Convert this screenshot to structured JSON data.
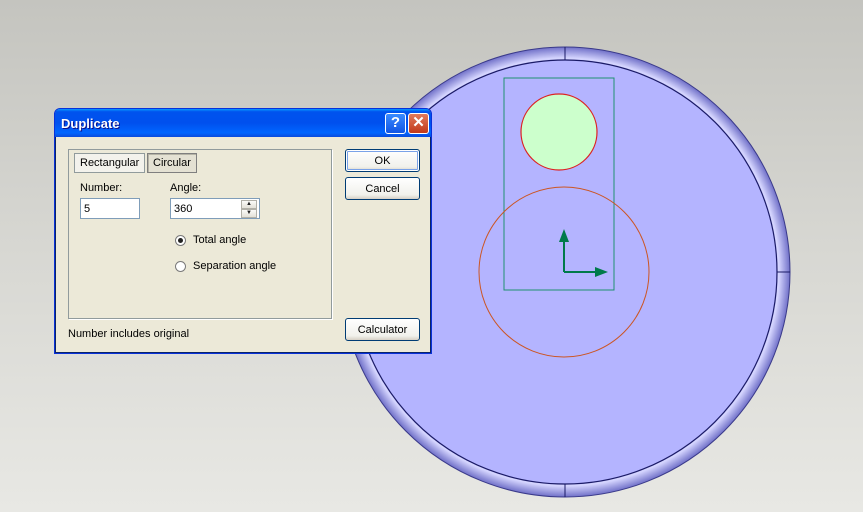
{
  "dialog": {
    "title": "Duplicate",
    "help_label": "?",
    "close_label": "✕",
    "tabs": [
      {
        "label": "Rectangular"
      },
      {
        "label": "Circular"
      }
    ],
    "selected_tab": "Circular",
    "number_label": "Number:",
    "number_value": "5",
    "angle_label": "Angle:",
    "angle_value": "360",
    "radio_total_label": "Total angle",
    "radio_separation_label": "Separation angle",
    "selected_radio": "Total angle",
    "ok_label": "OK",
    "cancel_label": "Cancel",
    "calculator_label": "Calculator",
    "footer_note": "Number includes original"
  },
  "icons": {
    "help": "question-icon",
    "close": "close-icon",
    "spin_up": "triangle-up-icon",
    "spin_down": "triangle-down-icon"
  },
  "colors": {
    "part_face": "#b4b4ff",
    "part_rim": "#8a8ae6",
    "part_outline": "#1a1a66",
    "selection_box": "#1f8f6f",
    "hole_fill": "#ccffcc",
    "hole_outline": "#dd2222",
    "pattern_circle": "#cc5522",
    "axis_arrow": "#007a4a",
    "titlebar": "#0054e3",
    "dialog_bg": "#ece9d8"
  }
}
